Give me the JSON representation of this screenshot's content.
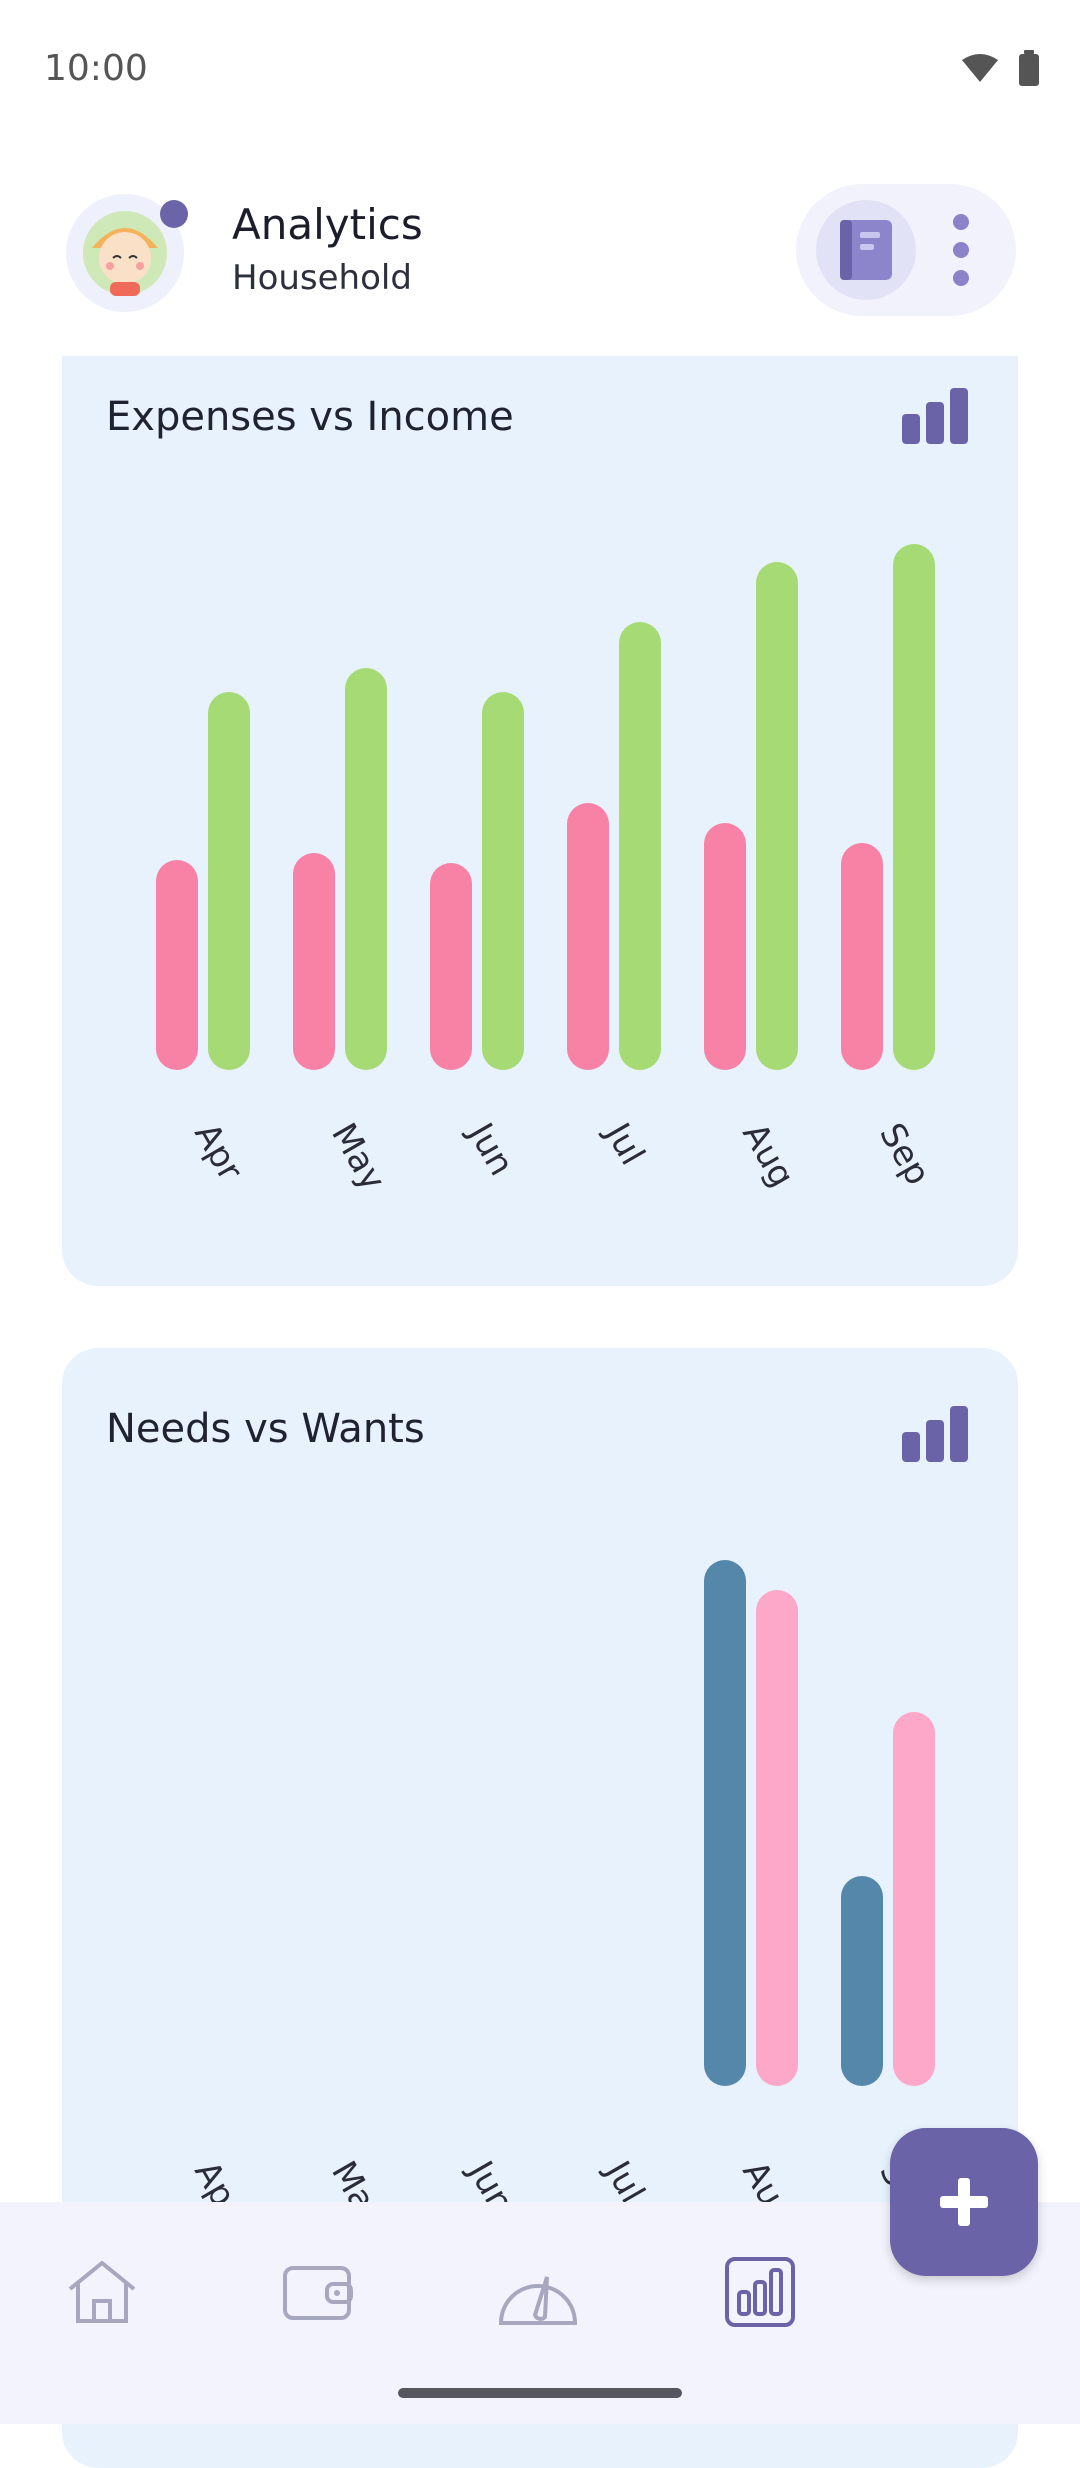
{
  "status_bar": {
    "time": "10:00"
  },
  "header": {
    "title": "Analytics",
    "subtitle": "Household"
  },
  "cards": [
    {
      "title": "Expenses vs Income",
      "icon": "bar-chart-icon"
    },
    {
      "title": "Needs vs Wants",
      "icon": "bar-chart-icon"
    }
  ],
  "chart_data": [
    {
      "type": "bar",
      "title": "Expenses vs Income",
      "categories": [
        "Apr",
        "May",
        "Jun",
        "Jul",
        "Aug",
        "Sep"
      ],
      "series": [
        {
          "values": [
            210,
            217,
            207,
            267,
            247,
            227
          ],
          "color": "#f882a6"
        },
        {
          "values": [
            378,
            402,
            378,
            448,
            508,
            526
          ],
          "color": "#a6da74"
        }
      ],
      "ylim": [
        0,
        526
      ],
      "grid": false
    },
    {
      "type": "bar",
      "title": "Needs vs Wants",
      "categories": [
        "Apr",
        "May",
        "Jun",
        "Jul",
        "Aug",
        "Sep"
      ],
      "series": [
        {
          "values": [
            0,
            0,
            0,
            0,
            526,
            210
          ],
          "color": "#5487aa"
        },
        {
          "values": [
            0,
            0,
            0,
            0,
            496,
            374
          ],
          "color": "#fda8c8"
        }
      ],
      "ylim": [
        0,
        526
      ],
      "grid": false
    }
  ],
  "nav": [
    "home-icon",
    "wallet-icon",
    "gauge-icon",
    "analytics-icon"
  ],
  "fab": {
    "icon": "plus-icon",
    "color": "#6a63a7"
  },
  "colors": {
    "accent": "#6a63a7",
    "card_bg": "#e8f2fc",
    "nav_bg": "#f2f3fc"
  }
}
